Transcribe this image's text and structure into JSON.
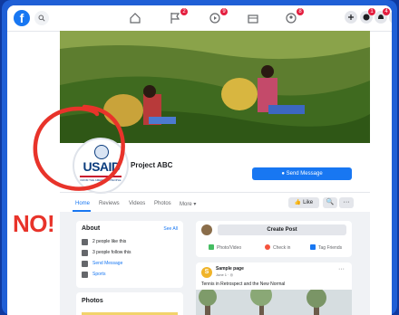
{
  "page": {
    "name": "Project ABC",
    "send_message_label": "Send Message",
    "tabs": [
      "Home",
      "Reviews",
      "Videos",
      "Photos",
      "More ▾"
    ],
    "like_label": "Like",
    "search_glyph": "🔍",
    "more_glyph": "···"
  },
  "topbar": {
    "badges": {
      "flag": "2",
      "watch": "9",
      "groups": "8",
      "messenger": "1",
      "notifications": "4"
    }
  },
  "about": {
    "title": "About",
    "see_all": "See All",
    "rows": [
      "2 people like this",
      "3 people follow this",
      "Send Message",
      "Sports"
    ]
  },
  "photos": {
    "title": "Photos"
  },
  "create_post": {
    "title": "Create Post",
    "actions": [
      "Photo/Video",
      "Check in",
      "Tag Friends"
    ]
  },
  "feed": {
    "author": "Sample page",
    "date": "June 1 · ◎",
    "text": "Tennis in Retrospect and the New Normal",
    "avatar_letter": "S"
  },
  "profile": {
    "logo_text": "USAID",
    "logo_subtext": "FROM THE AMERICAN PEOPLE"
  },
  "annotation": {
    "text": "NO!",
    "color": "#e8332a"
  },
  "colors": {
    "brand": "#1877f2",
    "frame": "#1f5fd6",
    "annotation": "#e8332a"
  }
}
